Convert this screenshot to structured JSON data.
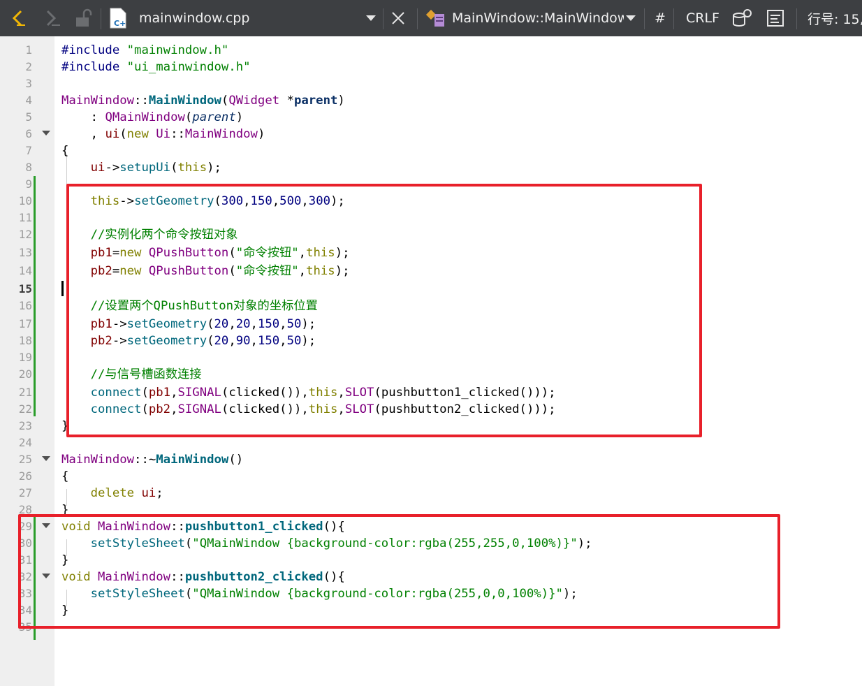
{
  "toolbar": {
    "file_name": "mainwindow.cpp",
    "function_name": "MainWindow::MainWindow(",
    "hash": "#",
    "line_ending": "CRLF",
    "position": "行号: 15, "
  },
  "editor": {
    "line_numbers": [
      "1",
      "2",
      "3",
      "4",
      "5",
      "6",
      "7",
      "8",
      "9",
      "10",
      "11",
      "12",
      "13",
      "14",
      "15",
      "16",
      "17",
      "18",
      "19",
      "20",
      "21",
      "22",
      "23",
      "24",
      "25",
      "26",
      "27",
      "28",
      "29",
      "30",
      "31",
      "32",
      "33",
      "34",
      "35"
    ],
    "current_line": "15",
    "lines": {
      "l1": [
        "#include ",
        "\"mainwindow.h\""
      ],
      "l2": [
        "#include ",
        "\"ui_mainwindow.h\""
      ],
      "l4": [
        "MainWindow",
        "::",
        "MainWindow",
        "(",
        "QWidget",
        " *",
        "parent",
        ")"
      ],
      "l5": [
        "    : ",
        "QMainWindow",
        "(",
        "parent",
        ")"
      ],
      "l6": [
        "    , ",
        "ui",
        "(",
        "new",
        " ",
        "Ui",
        "::",
        "MainWindow",
        ")"
      ],
      "l7": [
        "{"
      ],
      "l8": [
        "    ",
        "ui",
        "->",
        "setupUi",
        "(",
        "this",
        ");"
      ],
      "l10": [
        "    ",
        "this",
        "->",
        "setGeometry",
        "(",
        "300",
        ",",
        "150",
        ",",
        "500",
        ",",
        "300",
        ");"
      ],
      "l12": [
        "    //实例化两个命令按钮对象"
      ],
      "l13": [
        "    ",
        "pb1",
        "=",
        "new",
        " ",
        "QPushButton",
        "(",
        "\"命令按钮\"",
        ",",
        "this",
        ");"
      ],
      "l14": [
        "    ",
        "pb2",
        "=",
        "new",
        " ",
        "QPushButton",
        "(",
        "\"命令按钮\"",
        ",",
        "this",
        ");"
      ],
      "l16": [
        "    //设置两个QPushButton对象的坐标位置"
      ],
      "l17": [
        "    ",
        "pb1",
        "->",
        "setGeometry",
        "(",
        "20",
        ",",
        "20",
        ",",
        "150",
        ",",
        "50",
        ");"
      ],
      "l18": [
        "    ",
        "pb2",
        "->",
        "setGeometry",
        "(",
        "20",
        ",",
        "90",
        ",",
        "150",
        ",",
        "50",
        ");"
      ],
      "l20": [
        "    //与信号槽函数连接"
      ],
      "l21": [
        "    ",
        "connect",
        "(",
        "pb1",
        ",",
        "SIGNAL",
        "(clicked()),",
        "this",
        ",",
        "SLOT",
        "(pushbutton1_clicked()));"
      ],
      "l22": [
        "    ",
        "connect",
        "(",
        "pb2",
        ",",
        "SIGNAL",
        "(clicked()),",
        "this",
        ",",
        "SLOT",
        "(pushbutton2_clicked()));"
      ],
      "l23": [
        "}"
      ],
      "l25": [
        "MainWindow",
        "::~",
        "MainWindow",
        "()"
      ],
      "l26": [
        "{"
      ],
      "l27": [
        "    ",
        "delete",
        " ",
        "ui",
        ";"
      ],
      "l28": [
        "}"
      ],
      "l29": [
        "void",
        " ",
        "MainWindow",
        "::",
        "pushbutton1_clicked",
        "(){"
      ],
      "l30": [
        "    ",
        "setStyleSheet",
        "(",
        "\"QMainWindow {background-color:rgba(255,255,0,100%)}\"",
        ");"
      ],
      "l31": [
        "}"
      ],
      "l32": [
        "void",
        " ",
        "MainWindow",
        "::",
        "pushbutton2_clicked",
        "(){"
      ],
      "l33": [
        "    ",
        "setStyleSheet",
        "(",
        "\"QMainWindow {background-color:rgba(255,0,0,100%)}\"",
        ");"
      ],
      "l34": [
        "}"
      ]
    }
  },
  "colors": {
    "toolbar_bg": "#3d3f42",
    "highlight_box": "#e8202a",
    "change_bar": "#2a9d2a",
    "keyword": "#808000",
    "type": "#800080",
    "function": "#00677c",
    "string": "#008000"
  }
}
